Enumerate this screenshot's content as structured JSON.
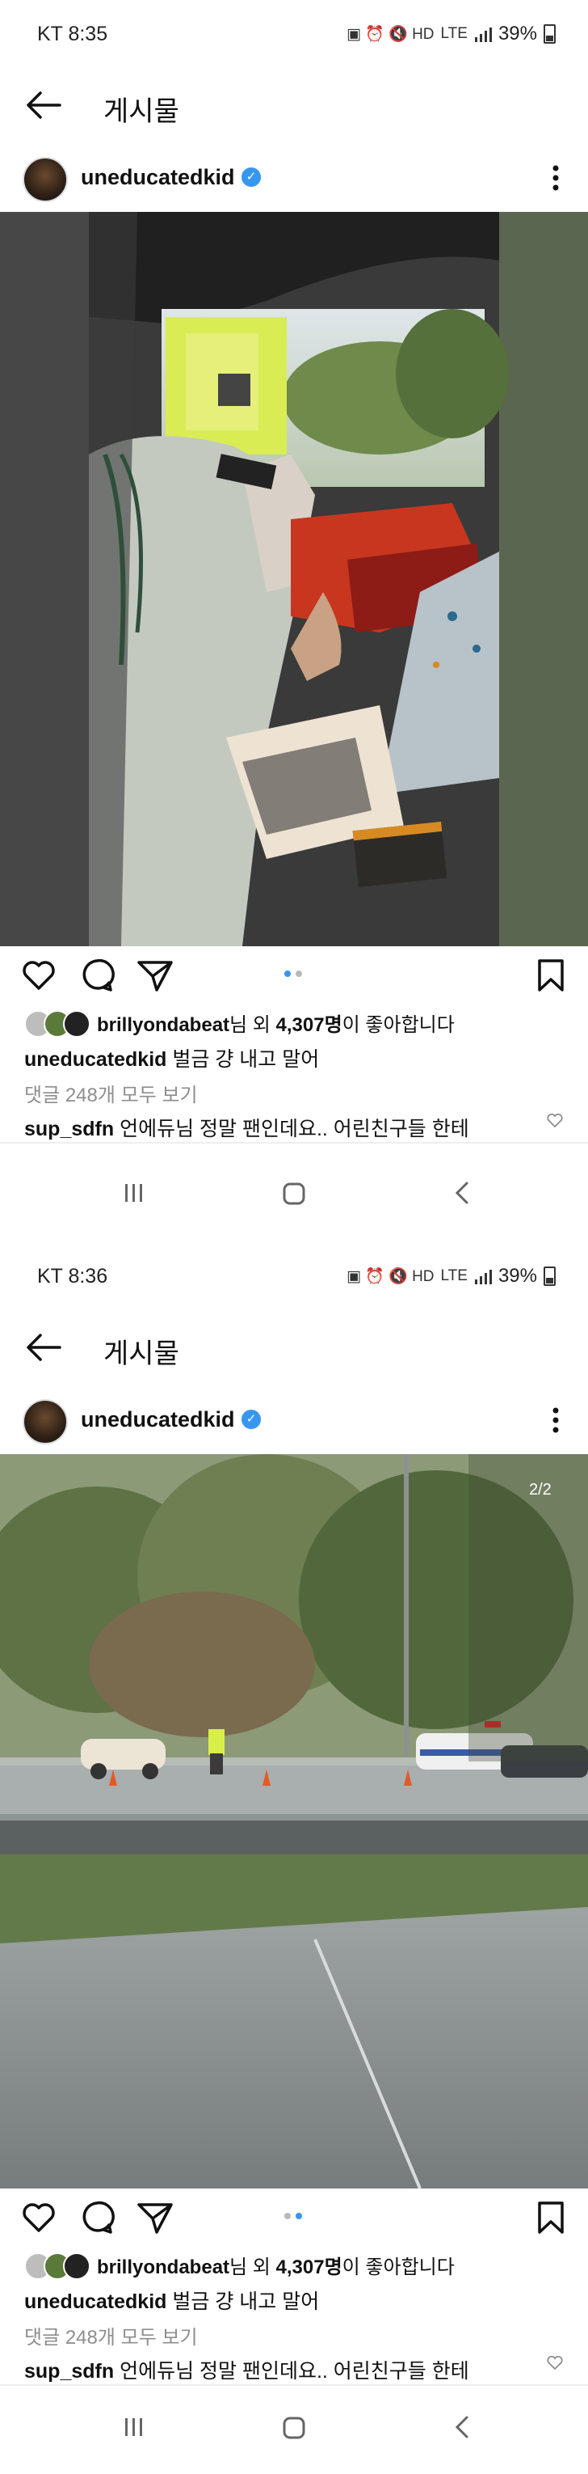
{
  "screens": [
    {
      "status": {
        "time": "KT 8:35",
        "network": "LTE",
        "battery": "39%"
      },
      "header": {
        "title": "게시물"
      },
      "post": {
        "username": "uneducatedkid",
        "likes_user": "brillyondabeat",
        "likes_mid": "님 외 ",
        "likes_count": "4,307명",
        "likes_suffix": "이 좋아합니다",
        "caption_user": "uneducatedkid",
        "caption_text": " 벌금 걍 내고 말어",
        "view_comments": "댓글 248개 모두 보기",
        "comment_user": "sup_sdfn",
        "comment_text": " 언에듀님 정말 팬인데요.. 어린친구들 한테"
      }
    },
    {
      "status": {
        "time": "KT 8:36",
        "network": "LTE",
        "battery": "39%"
      },
      "header": {
        "title": "게시물"
      },
      "post": {
        "username": "uneducatedkid",
        "media_counter": "2/2",
        "likes_user": "brillyondabeat",
        "likes_mid": "님 외 ",
        "likes_count": "4,307명",
        "likes_suffix": "이 좋아합니다",
        "caption_user": "uneducatedkid",
        "caption_text": " 벌금 걍 내고 말어",
        "view_comments": "댓글 248개 모두 보기",
        "comment_user": "sup_sdfn",
        "comment_text": " 언에듀님 정말 팬인데요.. 어린친구들 한테"
      }
    }
  ],
  "icons": [
    "back-arrow-icon",
    "verified-badge-icon",
    "more-options-icon",
    "heart-icon",
    "comment-icon",
    "share-icon",
    "bookmark-icon",
    "recent-apps-icon",
    "home-icon",
    "nav-back-icon"
  ],
  "colors": {
    "accent": "#3797f0",
    "muted_text": "#8e8e8e",
    "background": "#ffffff"
  }
}
